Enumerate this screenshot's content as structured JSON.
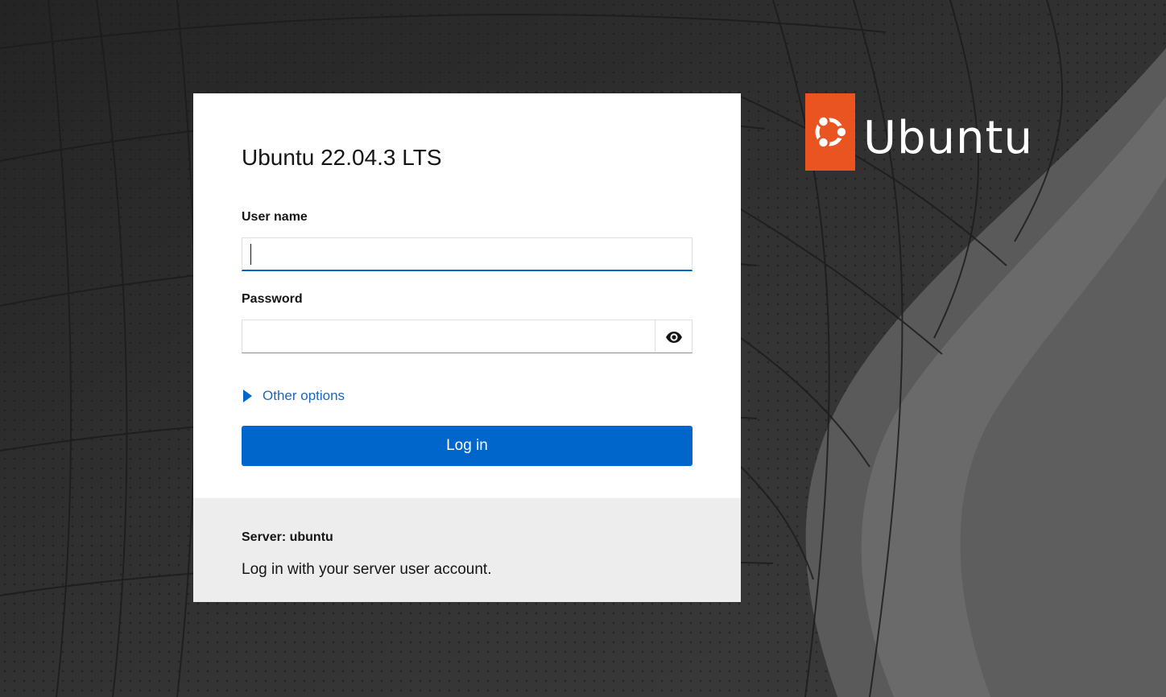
{
  "login": {
    "title": "Ubuntu 22.04.3 LTS",
    "username_label": "User name",
    "username_value": "",
    "password_label": "Password",
    "password_value": "",
    "reveal_icon": "eye-icon",
    "other_options_label": "Other options",
    "other_options_icon": "caret-right-icon",
    "login_button_label": "Log in"
  },
  "footer": {
    "server_label": "Server: ubuntu",
    "hint": "Log in with your server user account."
  },
  "brand": {
    "logo_icon": "ubuntu-circle-of-friends-icon",
    "name": "Ubuntu",
    "color": "#e95420"
  },
  "colors": {
    "accent": "#0066cc",
    "background": "#2a2a2a",
    "footer_background": "#ededed"
  }
}
